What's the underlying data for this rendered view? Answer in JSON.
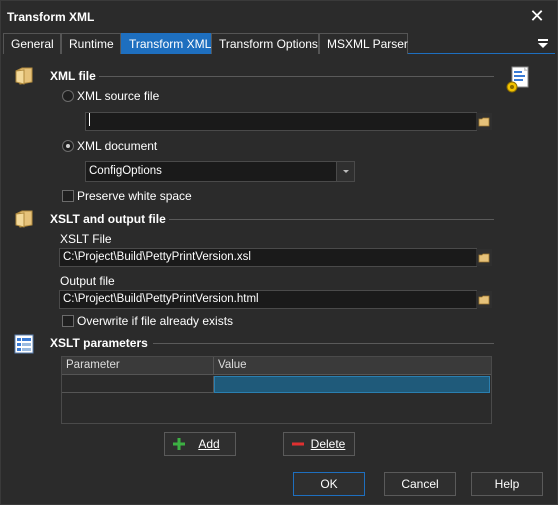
{
  "window": {
    "title": "Transform XML",
    "close_glyph": "✕"
  },
  "tabs": [
    {
      "label": "General"
    },
    {
      "label": "Runtime"
    },
    {
      "label": "Transform XML",
      "active": true
    },
    {
      "label": "Transform Options"
    },
    {
      "label": "MSXML Parser"
    }
  ],
  "xml_file": {
    "title": "XML file",
    "source_file_label": "XML source file",
    "source_file_selected": false,
    "source_file_value": "",
    "document_label": "XML document",
    "document_selected": true,
    "document_value": "ConfigOptions",
    "preserve_whitespace_label": "Preserve white space",
    "preserve_whitespace_checked": false
  },
  "xslt": {
    "title": "XSLT and output file",
    "xslt_file_label": "XSLT File",
    "xslt_file_value": "C:\\Project\\Build\\PettyPrintVersion.xsl",
    "output_file_label": "Output file",
    "output_file_value": "C:\\Project\\Build\\PettyPrintVersion.html",
    "overwrite_label": "Overwrite if file already exists",
    "overwrite_checked": false
  },
  "params": {
    "title": "XSLT parameters",
    "columns": [
      "Parameter",
      "Value"
    ],
    "add_label": "Add",
    "delete_label": "Delete"
  },
  "footer": {
    "ok_label": "OK",
    "cancel_label": "Cancel",
    "help_label": "Help"
  },
  "colors": {
    "accent": "#1e6fbf",
    "selected_cell": "#1f5a7a",
    "background": "#2b2b2b"
  },
  "icons": [
    "folder-icon",
    "xml-document-gear-icon",
    "list-icon",
    "plus-icon",
    "minus-icon",
    "browse-folder-icon",
    "menu-icon",
    "close-icon"
  ]
}
